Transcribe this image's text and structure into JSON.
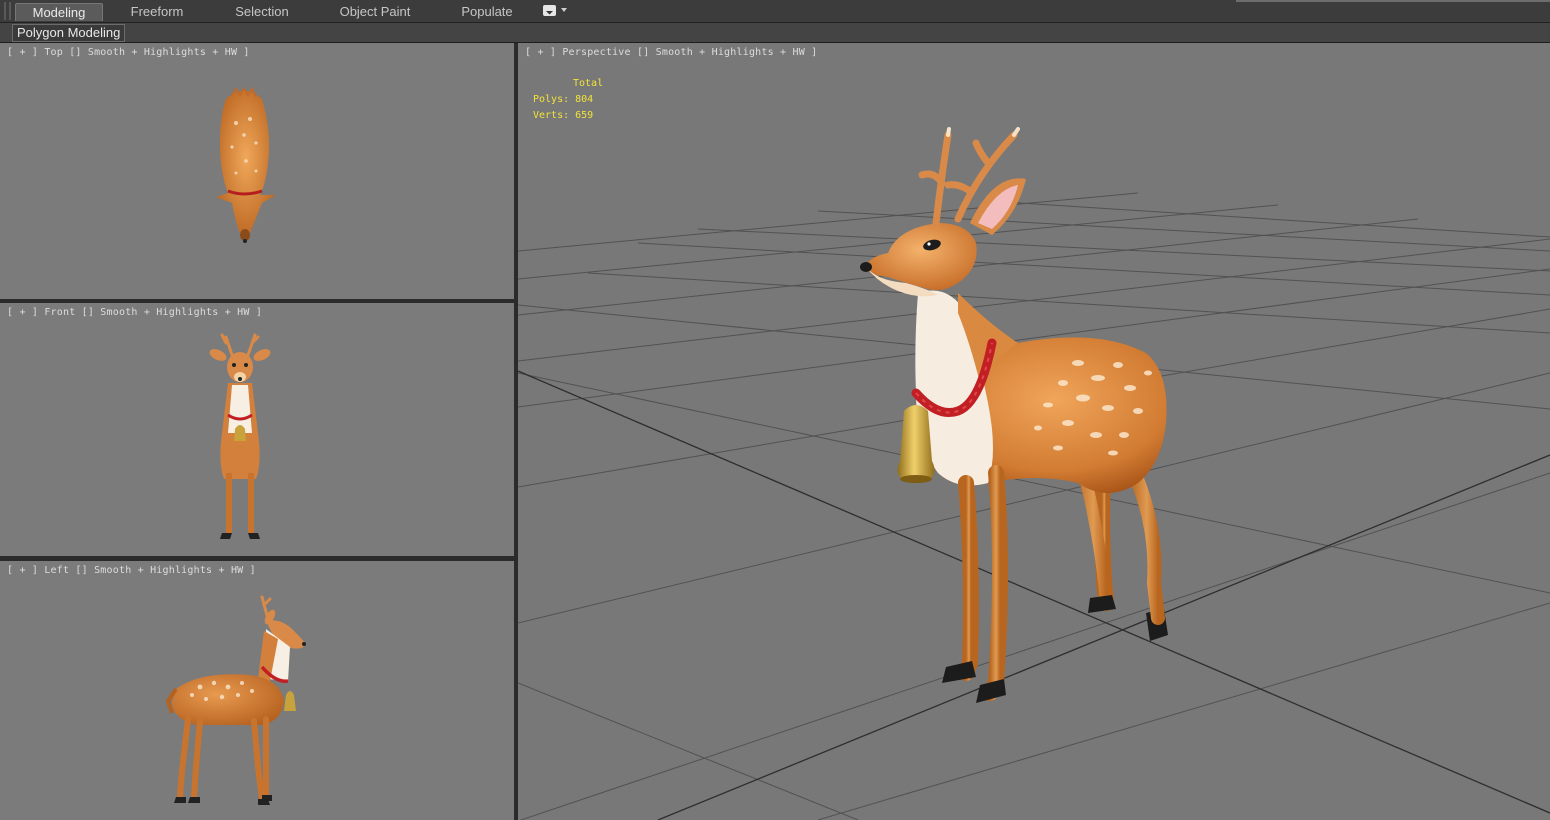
{
  "ribbon": {
    "tabs": [
      {
        "label": "Modeling",
        "active": true
      },
      {
        "label": "Freeform",
        "active": false
      },
      {
        "label": "Selection",
        "active": false
      },
      {
        "label": "Object Paint",
        "active": false
      },
      {
        "label": "Populate",
        "active": false
      }
    ],
    "options_icon": "ribbon-options-dropdown-icon",
    "panel_label": "Polygon Modeling"
  },
  "viewports": {
    "top": {
      "label": "[ + ] Top [] Smooth + Highlights + HW ]"
    },
    "front": {
      "label": "[ + ] Front [] Smooth + Highlights + HW ]"
    },
    "left": {
      "label": "[ + ] Left [] Smooth + Highlights + HW ]"
    },
    "perspective": {
      "label": "[ + ] Perspective [] Smooth + Highlights + HW ]",
      "stats": {
        "header": "Total",
        "polys": "Polys: 804",
        "verts": "Verts: 659"
      }
    }
  },
  "colors": {
    "viewport_bg": "#7b7b7b",
    "stats_text": "#f2e33a",
    "fawn_body": "#d9843a",
    "collar": "#c21f24",
    "bell": "#c8a23a"
  },
  "model": {
    "name_icon": "fawn-model-icon"
  }
}
